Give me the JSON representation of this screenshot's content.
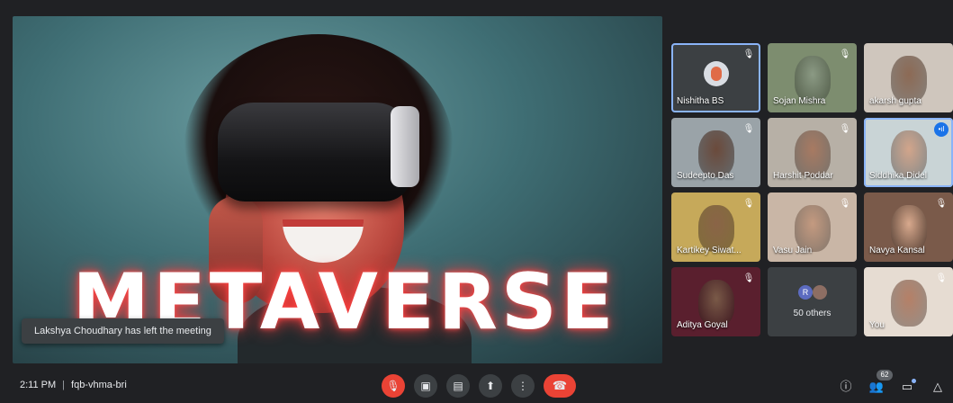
{
  "presentation": {
    "title_text": "METAVERSE"
  },
  "toast": {
    "message": "Lakshya Choudhary has left the meeting"
  },
  "participants": [
    {
      "name": "Nishitha BS",
      "bg": "#3c4043",
      "skin": "#f0a07a",
      "active": true,
      "mic_state": "muted"
    },
    {
      "name": "Sojan Mishra",
      "bg": "#7d8d6f",
      "skin": "#8b9a84",
      "active": false,
      "mic_state": "muted"
    },
    {
      "name": "akarsh gupta",
      "bg": "#cfc6bd",
      "skin": "#8c6a55",
      "active": false,
      "mic_state": "none"
    },
    {
      "name": "Sudeepto Das",
      "bg": "#9aa3a8",
      "skin": "#6b4a3b",
      "active": false,
      "mic_state": "muted"
    },
    {
      "name": "Harshit Poddar",
      "bg": "#b7b0a6",
      "skin": "#a87a62",
      "active": false,
      "mic_state": "muted"
    },
    {
      "name": "Siddhika Didel",
      "bg": "#c9d4d6",
      "skin": "#d2a58b",
      "active": true,
      "mic_state": "speaking"
    },
    {
      "name": "Kartikey Siwat...",
      "bg": "#c6a95a",
      "skin": "#8a6447",
      "active": false,
      "mic_state": "muted"
    },
    {
      "name": "Vasu Jain",
      "bg": "#c9b6a6",
      "skin": "#c49a80",
      "active": false,
      "mic_state": "muted"
    },
    {
      "name": "Navya Kansal",
      "bg": "#7a5a4a",
      "skin": "#d8a98d",
      "active": false,
      "mic_state": "muted"
    },
    {
      "name": "Aditya Goyal",
      "bg": "#5a1f2e",
      "skin": "#7a5a48",
      "active": false,
      "mic_state": "muted"
    },
    {
      "name": "50 others",
      "bg": "#3c4043",
      "skin": "",
      "active": false,
      "mic_state": "none",
      "others_initial": "R"
    },
    {
      "name": "You",
      "bg": "#e6dcd2",
      "skin": "#b58067",
      "active": false,
      "mic_state": "muted"
    }
  ],
  "bottom_bar": {
    "time": "2:11 PM",
    "separator": "|",
    "meeting_code": "fqb-vhma-bri",
    "participants_count": "62"
  },
  "colors": {
    "background": "#202124",
    "control": "#3c4043",
    "danger": "#ea4335",
    "accent": "#8ab4f8"
  }
}
